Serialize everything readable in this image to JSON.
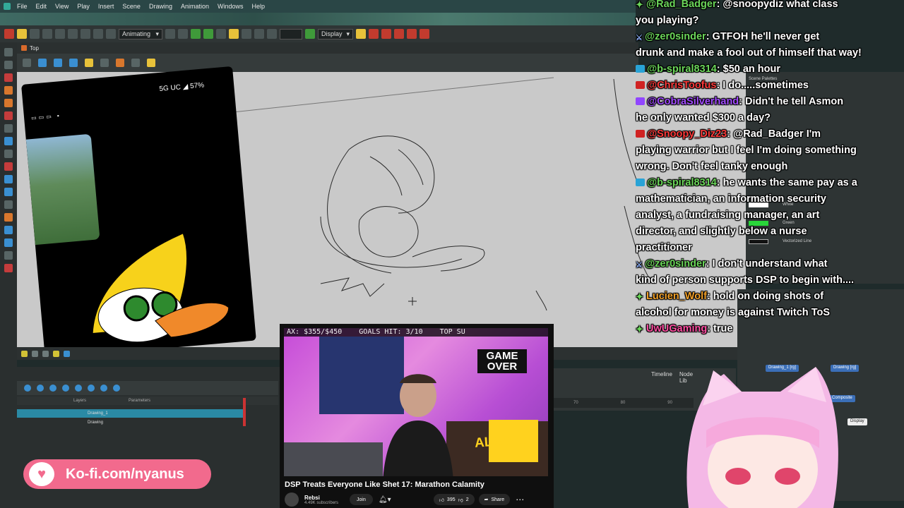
{
  "menu": {
    "items": [
      "File",
      "Edit",
      "View",
      "Play",
      "Insert",
      "Scene",
      "Drawing",
      "Animation",
      "Windows",
      "Help"
    ]
  },
  "toolbar": {
    "mode_select": "Animating",
    "display_select": "Display"
  },
  "view": {
    "tab_label": "Top"
  },
  "phone": {
    "status": "5G UC ◢ 57%"
  },
  "timeline": {
    "tabs": [
      "Timeline",
      "Node Lib"
    ],
    "header_layers": "Layers",
    "header_params": "Parameters",
    "layers": [
      "Drawing_1",
      "Drawing"
    ],
    "ruler": [
      "70",
      "80",
      "90"
    ]
  },
  "palette": {
    "title": "Scene Palettes",
    "rows": [
      {
        "name": "White",
        "color": "#ffffff"
      },
      {
        "name": "Green",
        "color": "#29d63a"
      },
      {
        "name": "Vectorized Line",
        "color": "#111111"
      }
    ]
  },
  "nodes": {
    "drawing_1": "Drawing_1 [rg]",
    "drawing": "Drawing [rg]",
    "composite": "Composite",
    "display": "Display"
  },
  "chat": [
    {
      "user": "@Rad_Badger",
      "user_color": "#6bd65a",
      "badge": "star",
      "text": ": @snoopydiz what class"
    },
    {
      "user": "",
      "user_color": "#ffffff",
      "badge": "",
      "text": "you playing?"
    },
    {
      "user": "@zer0sinder",
      "user_color": "#6bd65a",
      "badge": "sword",
      "text": ": GTFOH he'll never get"
    },
    {
      "user": "",
      "user_color": "#ffffff",
      "badge": "",
      "text": "drunk and make a fool out of himself that way!"
    },
    {
      "user": "@b-spiral8314",
      "user_color": "#6bd65a",
      "badge": "yt",
      "text": ": $50 an hour"
    },
    {
      "user": "@ChrisToofus",
      "user_color": "#ff3b3b",
      "badge": "red",
      "text": ": I do.....sometimes"
    },
    {
      "user": "@CobraSilverhand",
      "user_color": "#a24bff",
      "badge": "tw",
      "text": ": Didn't he tell Asmon"
    },
    {
      "user": "",
      "user_color": "#ffffff",
      "badge": "",
      "text": "he only wanted $300 a day?"
    },
    {
      "user": "@Snoopy_Diz23",
      "user_color": "#ff3b3b",
      "badge": "red",
      "text": ": @Rad_Badger I'm"
    },
    {
      "user": "",
      "user_color": "#ffffff",
      "badge": "",
      "text": "playing warrior but I feel I'm doing something"
    },
    {
      "user": "",
      "user_color": "#ffffff",
      "badge": "",
      "text": "wrong. Don't feel tanky enough"
    },
    {
      "user": "@b-spiral8314",
      "user_color": "#6bd65a",
      "badge": "yt",
      "text": ": he wants the same pay as a"
    },
    {
      "user": "",
      "user_color": "#ffffff",
      "badge": "",
      "text": "mathematician, an information security"
    },
    {
      "user": "",
      "user_color": "#ffffff",
      "badge": "",
      "text": "analyst, a fundraising manager, an art"
    },
    {
      "user": "",
      "user_color": "#ffffff",
      "badge": "",
      "text": "director, and slightly below a nurse"
    },
    {
      "user": "",
      "user_color": "#ffffff",
      "badge": "",
      "text": "practitioner"
    },
    {
      "user": "@zer0sinder",
      "user_color": "#6bd65a",
      "badge": "sword",
      "text": ": I don't understand what"
    },
    {
      "user": "",
      "user_color": "#ffffff",
      "badge": "",
      "text": "kind of person supports DSP to begin with...."
    },
    {
      "user": "Lucien_Wolf",
      "user_color": "#f2a12a",
      "badge": "star",
      "text": ": hold on doing shots of"
    },
    {
      "user": "",
      "user_color": "#ffffff",
      "badge": "",
      "text": "alcohol for money is against Twitch ToS"
    },
    {
      "user": "UwUGaming",
      "user_color": "#ff4fa3",
      "badge": "star",
      "text": ": true"
    }
  ],
  "video": {
    "ticker_max": "AX: $355/$450",
    "ticker_goals": "GOALS HIT: 3/10",
    "ticker_top": "TOP SU",
    "poster_line1": "GAME",
    "poster_line2": "OVER",
    "poster_side": "ALAMAN",
    "title": "DSP Treats Everyone Like Shet 17: Marathon Calamity",
    "channel": "Rebsi",
    "subs": "4.49K subscribers",
    "join": "Join",
    "likes": "395",
    "dislikes": "2",
    "share": "Share"
  },
  "kofi": {
    "url": "Ko-fi.com/nyanus"
  }
}
